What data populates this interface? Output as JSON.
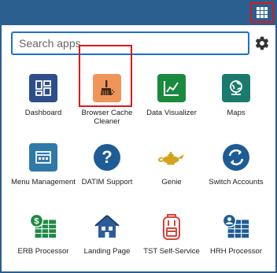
{
  "search": {
    "placeholder": "Search apps",
    "value": ""
  },
  "apps": [
    {
      "label": "Dashboard",
      "icon": "dashboard-icon",
      "color": "#2d4e8a"
    },
    {
      "label": "Browser Cache Cleaner",
      "icon": "broom-icon",
      "color": "#f0955a",
      "highlighted": true
    },
    {
      "label": "Data Visualizer",
      "icon": "line-chart-icon",
      "color": "#1a8a3e"
    },
    {
      "label": "Maps",
      "icon": "globe-icon",
      "color": "#1a7a6e"
    },
    {
      "label": "Menu Management",
      "icon": "window-icon",
      "color": "#2f79a9"
    },
    {
      "label": "DATIM Support",
      "icon": "question-icon",
      "color": "#1d5c95"
    },
    {
      "label": "Genie",
      "icon": "genie-lamp-icon",
      "color": "#d4a21b"
    },
    {
      "label": "Switch Accounts",
      "icon": "switch-accounts-icon",
      "color": "#1d5c95"
    },
    {
      "label": "ERB Processor",
      "icon": "spreadsheet-dollar-icon",
      "color": "#1f8a44"
    },
    {
      "label": "Landing Page",
      "icon": "house-icon",
      "color": "#2e5c9a"
    },
    {
      "label": "TST Self-Service",
      "icon": "backpack-icon",
      "color": "#d9423a"
    },
    {
      "label": "HRH Processor",
      "icon": "user-table-icon",
      "color": "#1d5c95"
    }
  ]
}
